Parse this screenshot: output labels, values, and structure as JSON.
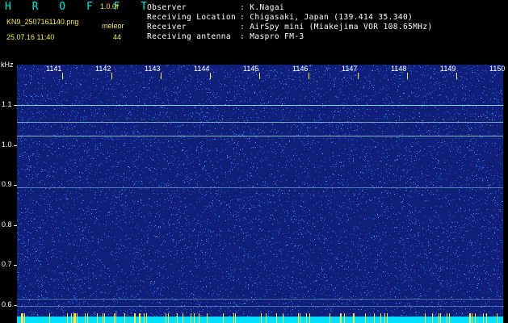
{
  "header": {
    "app_name": "H R O F F T",
    "version": "1.0.0f",
    "filename": "KN9_2507161140.png",
    "datetime": "25.07.16 11:40",
    "mode": "meleor",
    "count": "44"
  },
  "station": {
    "observer_label": "Observer",
    "observer_value": ": K.Nagai",
    "location_label": "Receiving Location",
    "location_value": ": Chigasaki, Japan (139.414 35.340)",
    "receiver_label": "Receiver",
    "receiver_value": ": AirSpy mini (Miakejima VOR 108.65MHz)",
    "antenna_label": "Receiving antenna",
    "antenna_value": ": Maspro FM-3"
  },
  "axes": {
    "y_unit": "kHz",
    "x_ticks": [
      "1141",
      "1142",
      "1143",
      "1144",
      "1145",
      "1146",
      "1147",
      "1148",
      "1149",
      "1150"
    ],
    "y_ticks": [
      {
        "label": "1.1",
        "v": 1.1
      },
      {
        "label": "1.0",
        "v": 1.0
      },
      {
        "label": "0.9",
        "v": 0.9
      },
      {
        "label": "0.8",
        "v": 0.8
      },
      {
        "label": "0.7",
        "v": 0.7
      },
      {
        "label": "0.6",
        "v": 0.6
      }
    ]
  },
  "colors": {
    "background": "#000000",
    "spectrum_bg": "#10207a",
    "noise": "#4da3ff",
    "carrier": "#9ff3e8",
    "title": "#00e5d8",
    "accent_yellow": "#f2e84a",
    "bottom_bar": "#00e0ff"
  }
}
